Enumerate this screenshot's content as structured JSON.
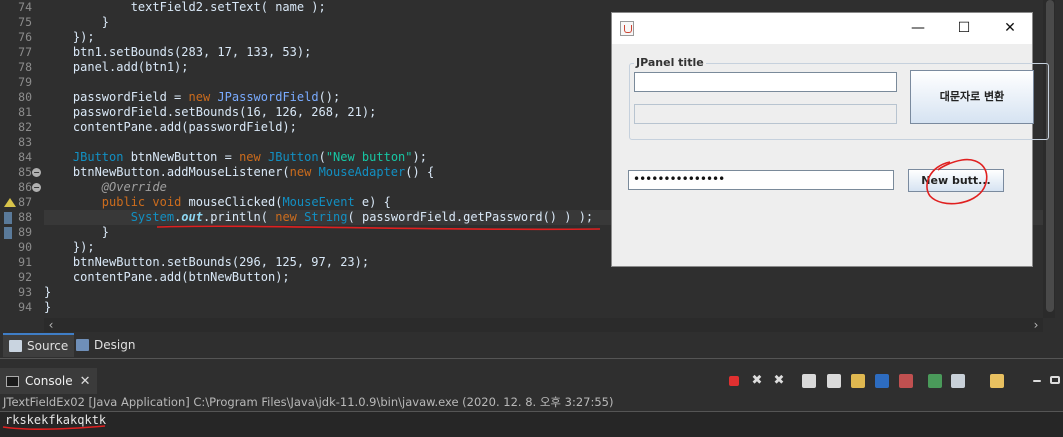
{
  "editor": {
    "lines": [
      {
        "n": "74",
        "tokens": [
          [
            "pl",
            "            textField2.setText( name );"
          ]
        ]
      },
      {
        "n": "75",
        "tokens": [
          [
            "pl",
            "        }"
          ]
        ]
      },
      {
        "n": "76",
        "tokens": [
          [
            "pl",
            "    });"
          ]
        ]
      },
      {
        "n": "77",
        "tokens": [
          [
            "pl",
            "    btn1.setBounds(283, 17, 133, 53);"
          ]
        ]
      },
      {
        "n": "78",
        "tokens": [
          [
            "pl",
            "    panel.add(btn1);"
          ]
        ]
      },
      {
        "n": "79",
        "tokens": []
      },
      {
        "n": "80",
        "tokens": [
          [
            "pl",
            "    passwordField = "
          ],
          [
            "k",
            "new"
          ],
          [
            "pl",
            " "
          ],
          [
            "v",
            "JPasswordField"
          ],
          [
            "pl",
            "();"
          ]
        ]
      },
      {
        "n": "81",
        "tokens": [
          [
            "pl",
            "    passwordField.setBounds(16, 126, 268, 21);"
          ]
        ]
      },
      {
        "n": "82",
        "tokens": [
          [
            "pl",
            "    contentPane.add(passwordField);"
          ]
        ]
      },
      {
        "n": "83",
        "tokens": []
      },
      {
        "n": "84",
        "tokens": [
          [
            "pl",
            "    "
          ],
          [
            "ty",
            "JButton"
          ],
          [
            "pl",
            " btnNewButton = "
          ],
          [
            "k",
            "new"
          ],
          [
            "pl",
            " "
          ],
          [
            "ty",
            "JButton"
          ],
          [
            "pl",
            "("
          ],
          [
            "s",
            "\"New button\""
          ],
          [
            "pl",
            ");"
          ]
        ]
      },
      {
        "n": "85",
        "tokens": [
          [
            "pl",
            "    btnNewButton.addMouseListener("
          ],
          [
            "k",
            "new"
          ],
          [
            "pl",
            " "
          ],
          [
            "ty",
            "MouseAdapter"
          ],
          [
            "pl",
            "() {"
          ]
        ]
      },
      {
        "n": "86",
        "tokens": [
          [
            "pl",
            "        "
          ],
          [
            "a",
            "@Override"
          ]
        ]
      },
      {
        "n": "87",
        "tokens": [
          [
            "pl",
            "        "
          ],
          [
            "k",
            "public"
          ],
          [
            "pl",
            " "
          ],
          [
            "k",
            "void"
          ],
          [
            "pl",
            " mouseClicked("
          ],
          [
            "ty",
            "MouseEvent"
          ],
          [
            "pl",
            " e) {"
          ]
        ]
      },
      {
        "n": "88",
        "tokens": [
          [
            "pl",
            "            "
          ],
          [
            "ty",
            "System"
          ],
          [
            "pl",
            "."
          ],
          [
            "st",
            "out"
          ],
          [
            "pl",
            ".println( "
          ],
          [
            "k",
            "new"
          ],
          [
            "pl",
            " "
          ],
          [
            "ty",
            "String"
          ],
          [
            "pl",
            "( passwordField.getPassword() ) );"
          ]
        ]
      },
      {
        "n": "89",
        "tokens": [
          [
            "pl",
            "        }"
          ]
        ]
      },
      {
        "n": "90",
        "tokens": [
          [
            "pl",
            "    });"
          ]
        ]
      },
      {
        "n": "91",
        "tokens": [
          [
            "pl",
            "    btnNewButton.setBounds(296, 125, 97, 23);"
          ]
        ]
      },
      {
        "n": "92",
        "tokens": [
          [
            "pl",
            "    contentPane.add(btnNewButton);"
          ]
        ]
      },
      {
        "n": "93",
        "tokens": [
          [
            "pl",
            "}"
          ]
        ]
      },
      {
        "n": "94",
        "tokens": [
          [
            "pl",
            "}"
          ]
        ]
      }
    ]
  },
  "editor_tabs": {
    "source_label": "Source",
    "design_label": "Design"
  },
  "console": {
    "tab_label": "Console",
    "info": "JTextFieldEx02 [Java Application] C:\\Program Files\\Java\\jdk-11.0.9\\bin\\javaw.exe  (2020. 12. 8. 오후 3:27:55)",
    "output": "rkskekfkakqktk"
  },
  "swing_window": {
    "panel_title": "JPanel title",
    "convert_button": "대문자로 변환",
    "new_button": "New butt...",
    "password_mask": "•••••••••••••••",
    "minimize_glyph": "—",
    "maximize_glyph": "☐",
    "close_glyph": "✕"
  },
  "colors": {
    "annotation_red": "#e02020",
    "editor_bg": "#2f2f2f"
  }
}
